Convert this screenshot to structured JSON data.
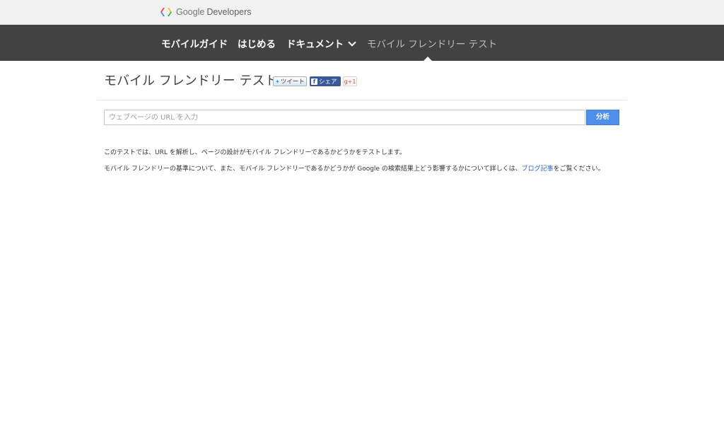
{
  "header": {
    "brand_google": "Google",
    "brand_developers": "Developers"
  },
  "nav": {
    "items": [
      {
        "label": "モバイルガイド"
      },
      {
        "label": "はじめる"
      },
      {
        "label": "ドキュメント"
      },
      {
        "label": "モバイル フレンドリー テスト"
      }
    ],
    "active_index": 3
  },
  "main": {
    "title": "モバイル フレンドリー テスト",
    "share": {
      "tweet_label": "ツイート",
      "facebook_label": "シェア",
      "gplus_label": "g+1"
    },
    "url_placeholder": "ウェブページの URL を入力",
    "url_value": "",
    "analyze_label": "分析",
    "description_1": "このテストでは、URL を解析し、ページの設計がモバイル フレンドリーであるかどうかをテストします。",
    "description_2_before": "モバイル フレンドリーの基準について、また、モバイル フレンドリーであるかどうかが Google の検索結果上どう影響するかについて詳しくは、",
    "description_2_link": "ブログ記事",
    "description_2_after": "をご覧ください。"
  },
  "colors": {
    "nav_background": "#424242",
    "topbar_background": "#f1f1f1",
    "accent_button": "#4d8fea",
    "link": "#3367d6"
  }
}
